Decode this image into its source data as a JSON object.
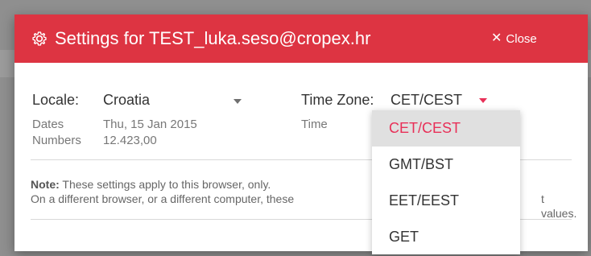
{
  "background": {
    "right_fragment": "s"
  },
  "dialog": {
    "title": "Settings for TEST_luka.seso@cropex.hr",
    "close_label": "Close",
    "header_color": "#dd3442",
    "icons": {
      "title_icon": "gear-icon",
      "close_icon": "close-icon"
    }
  },
  "locale": {
    "label": "Locale:",
    "value": "Croatia",
    "caret_icon": "caret-down-icon"
  },
  "timezone": {
    "label": "Time Zone:",
    "value": "CET/CEST",
    "caret_color": "#e83058",
    "caret_icon": "caret-down-icon"
  },
  "format_preview": {
    "dates_label": "Dates",
    "dates_value": "Thu, 15 Jan 2015",
    "numbers_label": "Numbers",
    "numbers_value": "12.423,00",
    "time_label": "Time"
  },
  "note": {
    "strong": "Note:",
    "line1": "These settings apply to this browser, only.",
    "line2_start": "On a different browser, or a different computer, these",
    "line2_end": "t values."
  },
  "timezone_dropdown": {
    "options": [
      "CET/CEST",
      "GMT/BST",
      "EET/EEST",
      "GET"
    ],
    "selected": "CET/CEST",
    "selected_text_color": "#e83058",
    "selected_background": "#e0e0e0"
  }
}
